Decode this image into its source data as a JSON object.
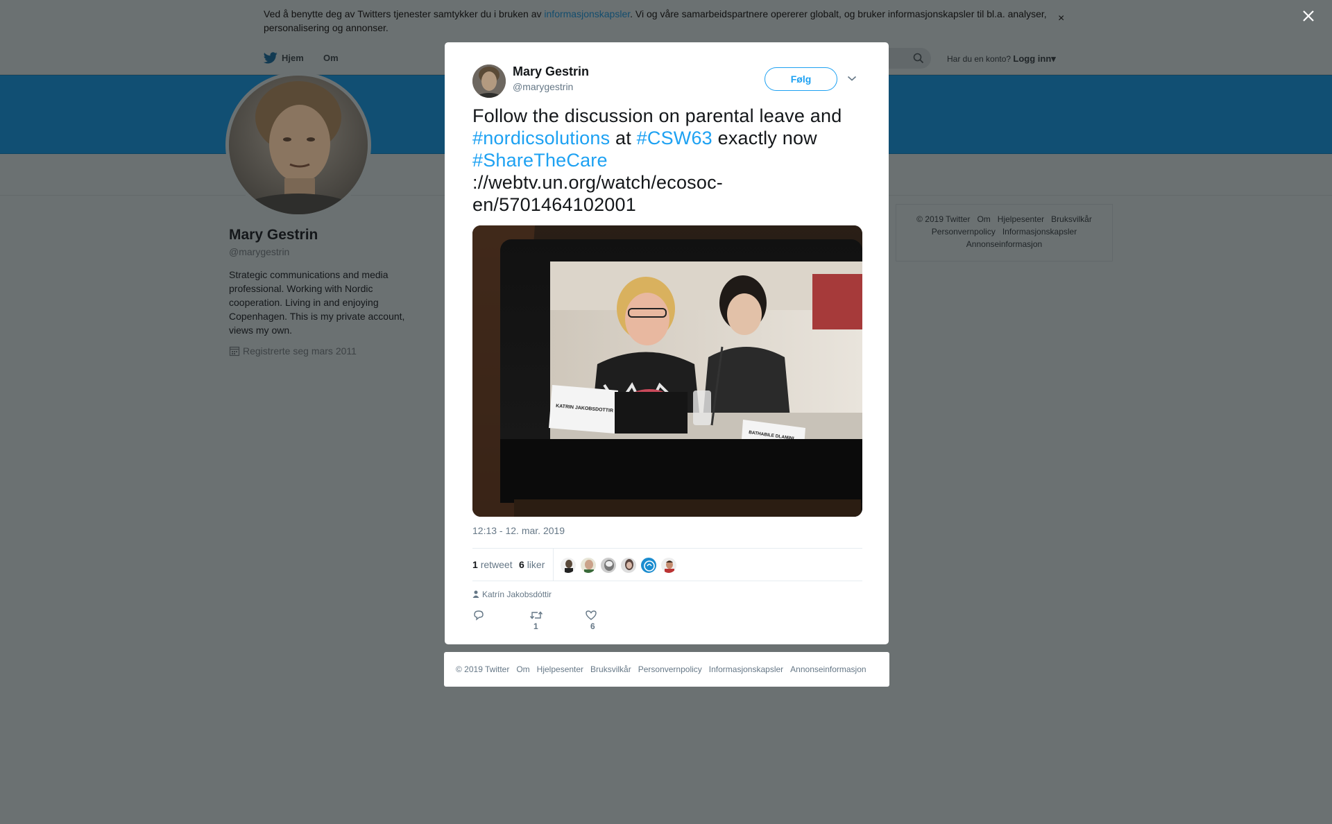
{
  "cookie_banner": {
    "text_before": "Ved å benytte deg av Twitters tjenester samtykker du i bruken av ",
    "link": "informasjonskapsler",
    "text_after": ". Vi og våre samarbeidspartnere opererer globalt, og bruker informasjonskapsler til bl.a. analyser, personalisering og annonser.",
    "close": "×"
  },
  "topnav": {
    "home": "Hjem",
    "about": "Om",
    "account_question": "Har du en konto?",
    "login": "Logg inn"
  },
  "profile": {
    "name": "Mary Gestrin",
    "handle": "@marygestrin",
    "bio": "Strategic communications and media professional. Working with Nordic cooperation. Living in and enjoying Copenhagen. This is my private account, views my own.",
    "joined": "Registrerte seg mars 2011"
  },
  "side_footer": {
    "links": [
      "© 2019 Twitter",
      "Om",
      "Hjelpesenter",
      "Bruksvilkår",
      "Personvernpolicy",
      "Informasjonskapsler",
      "Annonseinformasjon"
    ]
  },
  "tweet": {
    "author_name": "Mary Gestrin",
    "author_handle": "@marygestrin",
    "follow_label": "Følg",
    "text_1": "Follow the discussion on parental leave and ",
    "hashtag_1": "#nordicsolutions",
    "text_2": " at ",
    "hashtag_2": "#CSW63",
    "text_3": " exactly now ",
    "hashtag_3": "#ShareTheCare",
    "text_4": " ://webtv.un.org/watch/ecosoc-en/5701464102001",
    "timestamp": "12:13 - 12. mar. 2019",
    "retweet_count": "1",
    "retweet_label": "retweet",
    "like_count": "6",
    "like_label": "liker",
    "mention": "Katrín Jakobsdóttir",
    "action_retweets": "1",
    "action_likes": "6",
    "media_labels": {
      "nameplate_1": "KATRIN JAKOBSDOTTIR",
      "nameplate_2": "BATHABILE DLAMINI"
    }
  },
  "modal_footer": {
    "links": [
      "© 2019 Twitter",
      "Om",
      "Hjelpesenter",
      "Bruksvilkår",
      "Personvernpolicy",
      "Informasjonskapsler",
      "Annonseinformasjon"
    ]
  },
  "icons": {
    "twitter_bird": "twitter-bird-icon",
    "search": "search-icon",
    "calendar": "calendar-icon",
    "reply": "reply-icon",
    "retweet": "retweet-icon",
    "like": "heart-icon",
    "close": "close-icon"
  },
  "colors": {
    "accent": "#1da1f2",
    "overlay": "#6b7172",
    "banner": "#114f73"
  }
}
